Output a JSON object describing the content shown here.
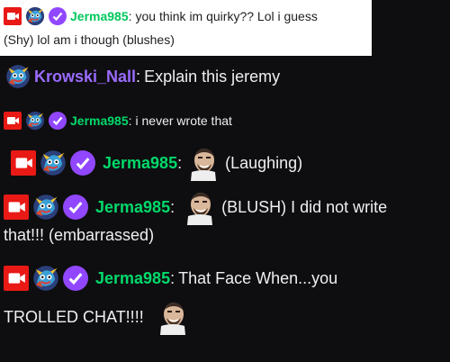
{
  "colors": {
    "background": "#0e0e10",
    "card": "#ffffff",
    "jerma": "#00d96b",
    "krowski": "#9b6bff",
    "badge_red": "#e91916",
    "verified": "#9147ff"
  },
  "messages": [
    {
      "user": "Jerma985",
      "sep": ":",
      "text": "you think im quirky?? Lol i guess",
      "cont": "(Shy) lol am i though (blushes)",
      "badges": [
        "camera-badge-icon",
        "subscriber-badge-icon",
        "verified-badge-icon"
      ]
    },
    {
      "user": "Krowski_Nall",
      "sep": ":",
      "text": "Explain this jeremy",
      "badges": [
        "subscriber-badge-icon"
      ]
    },
    {
      "user": "Jerma985",
      "sep": ":",
      "text": "i never wrote that",
      "badges": [
        "camera-badge-icon",
        "subscriber-badge-icon",
        "verified-badge-icon"
      ]
    },
    {
      "user": "Jerma985",
      "sep": ":",
      "text": "(Laughing)",
      "emote": "jerma-face-emote",
      "badges": [
        "camera-badge-icon",
        "subscriber-badge-icon",
        "verified-badge-icon"
      ]
    },
    {
      "user": "Jerma985",
      "sep": ":",
      "text": "(BLUSH) I did not write",
      "cont": "that!!! (embarrassed)",
      "emote": "jerma-face-emote",
      "badges": [
        "camera-badge-icon",
        "subscriber-badge-icon",
        "verified-badge-icon"
      ]
    },
    {
      "user": "Jerma985",
      "sep": ":",
      "text": "That Face When...you",
      "cont": "TROLLED CHAT!!!!",
      "emote": "jerma-face-emote",
      "badges": [
        "camera-badge-icon",
        "subscriber-badge-icon",
        "verified-badge-icon"
      ]
    }
  ]
}
